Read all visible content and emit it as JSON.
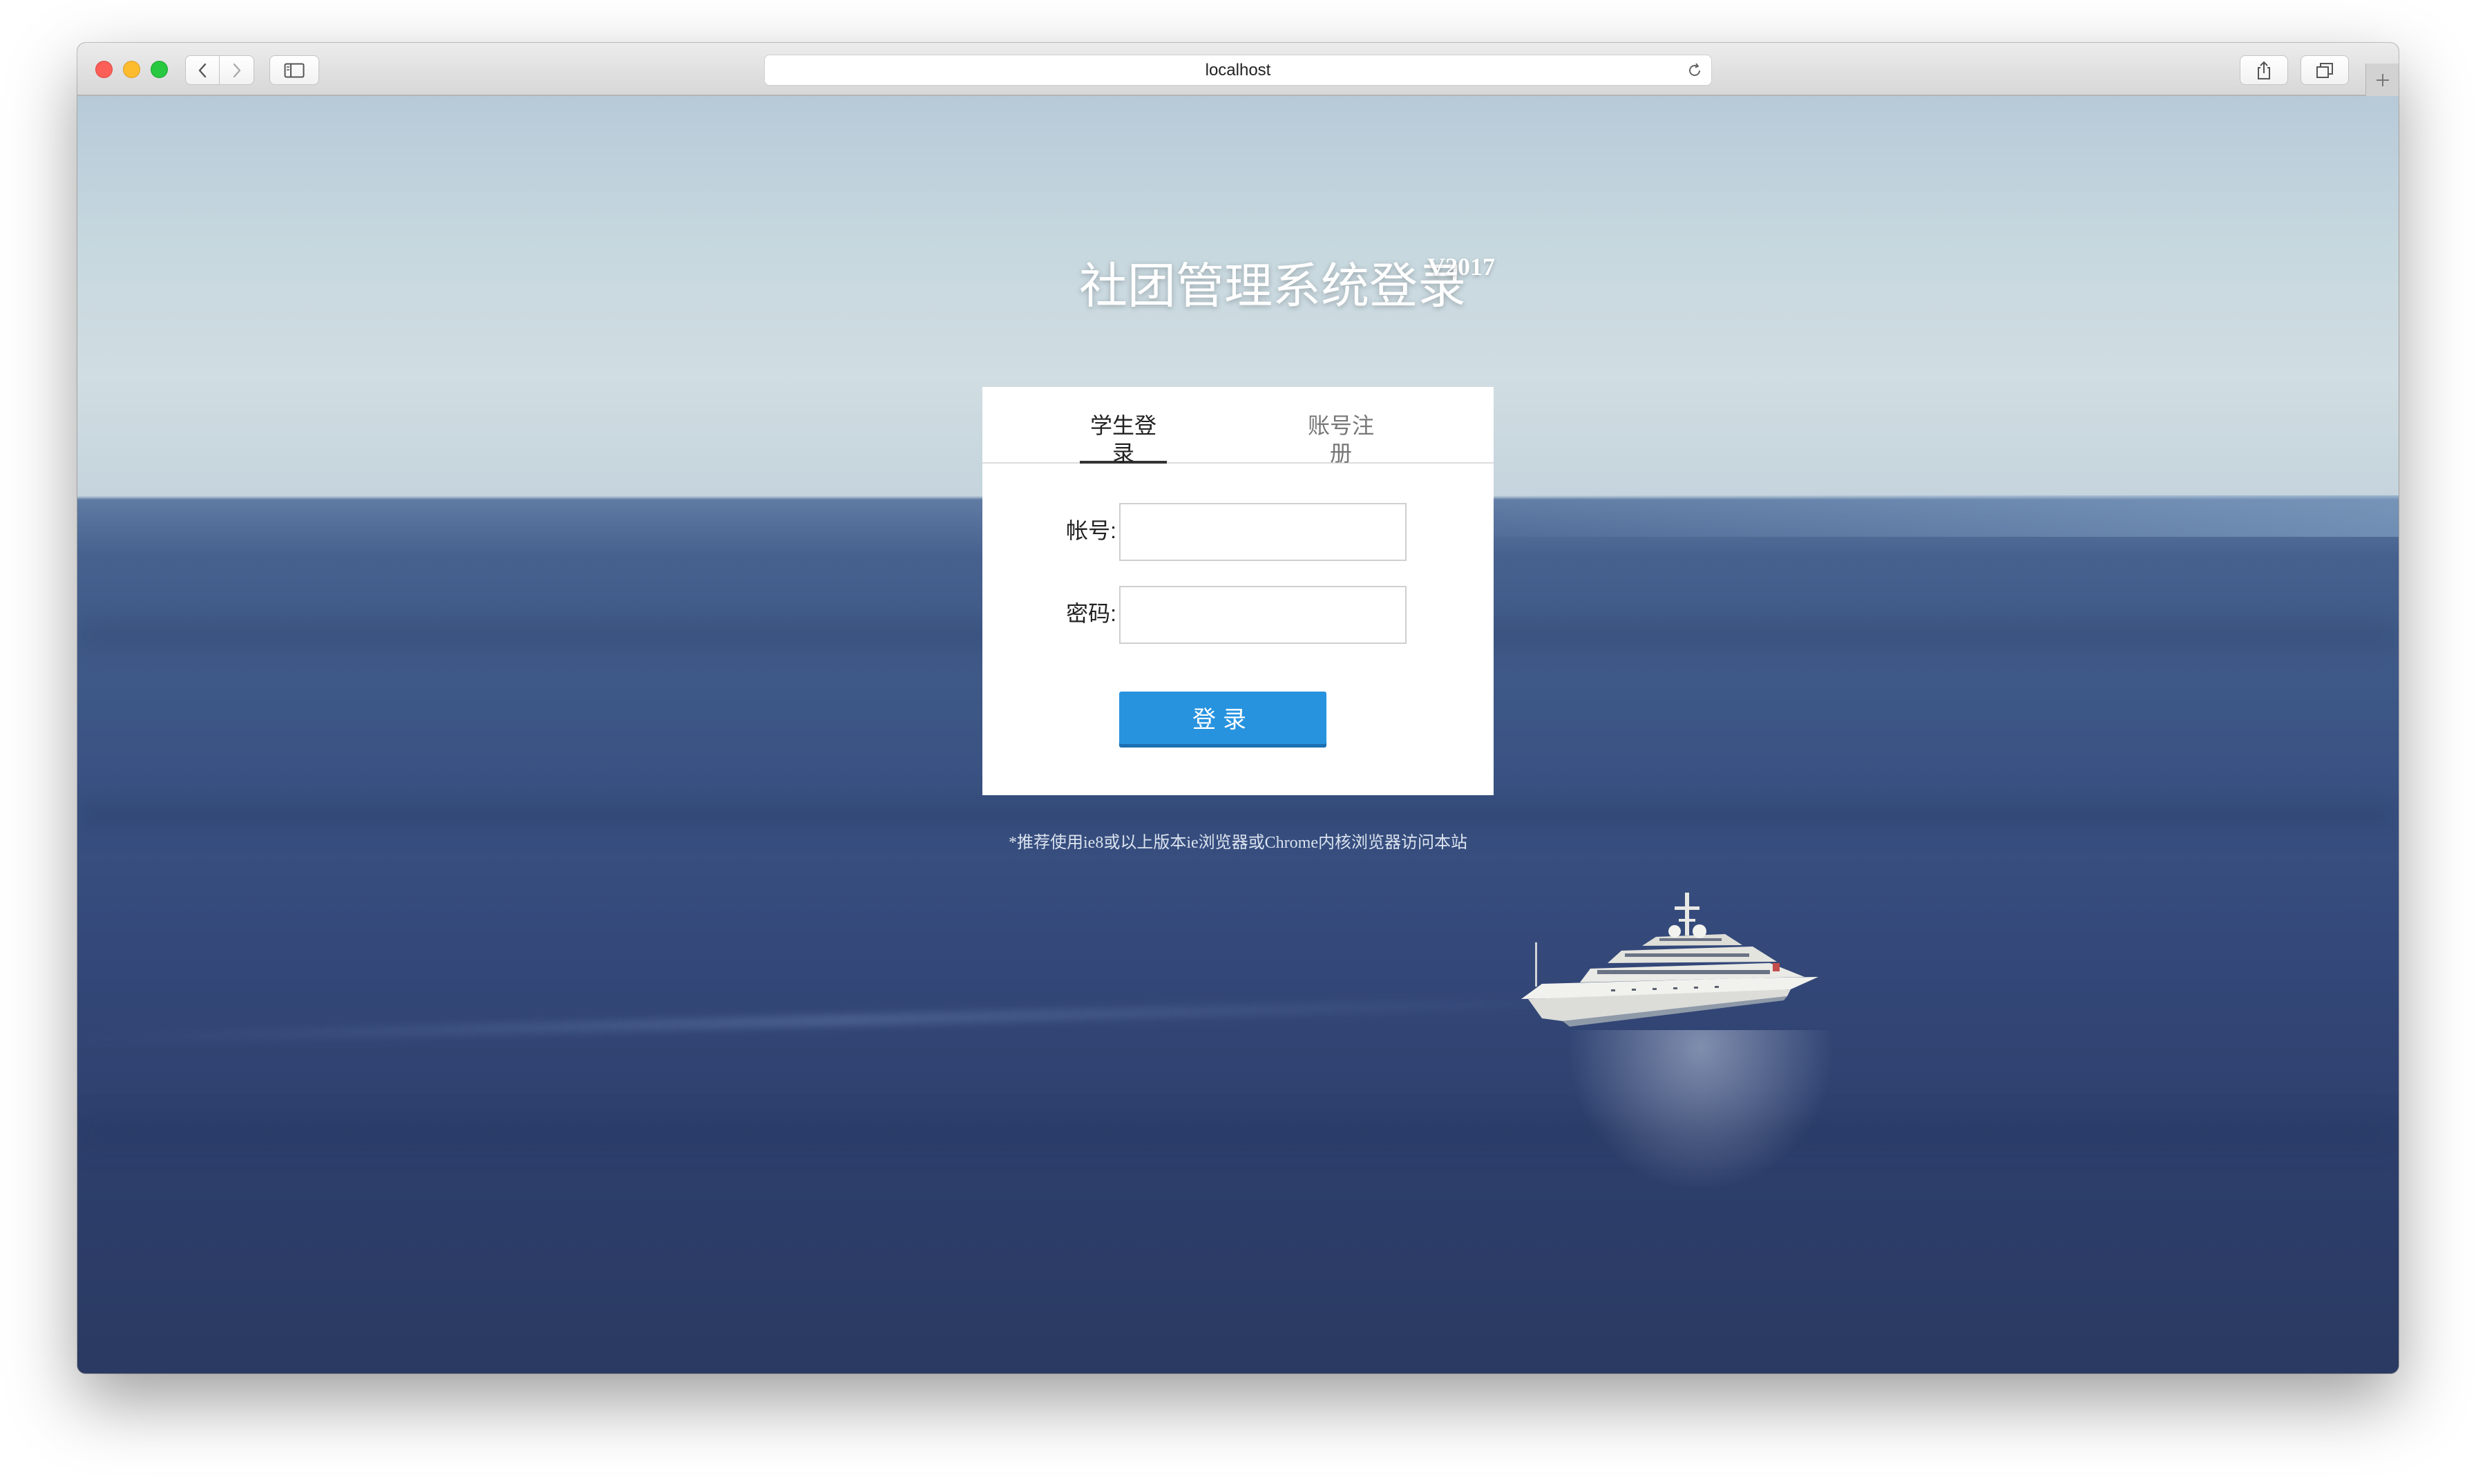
{
  "browser": {
    "address": "localhost",
    "icons": {
      "back": "chevron-left-icon",
      "forward": "chevron-right-icon",
      "sidebar": "sidebar-icon",
      "reload": "reload-icon",
      "share": "share-icon",
      "tabs": "tabs-overview-icon",
      "new_tab": "plus-icon"
    }
  },
  "page": {
    "title": "社团管理系统登录",
    "version": "V2017",
    "tabs": [
      {
        "label": "学生登录",
        "active": true
      },
      {
        "label": "账号注册",
        "active": false
      }
    ],
    "form": {
      "account_label": "帐号:",
      "account_value": "",
      "password_label": "密码:",
      "password_value": "",
      "submit_label": "登录"
    },
    "tip": "*推荐使用ie8或以上版本ie浏览器或Chrome内核浏览器访问本站"
  },
  "colors": {
    "button": "#2793df",
    "accent_tab": "#333333",
    "sky": "#c7d8df",
    "sea": "#34497a"
  }
}
